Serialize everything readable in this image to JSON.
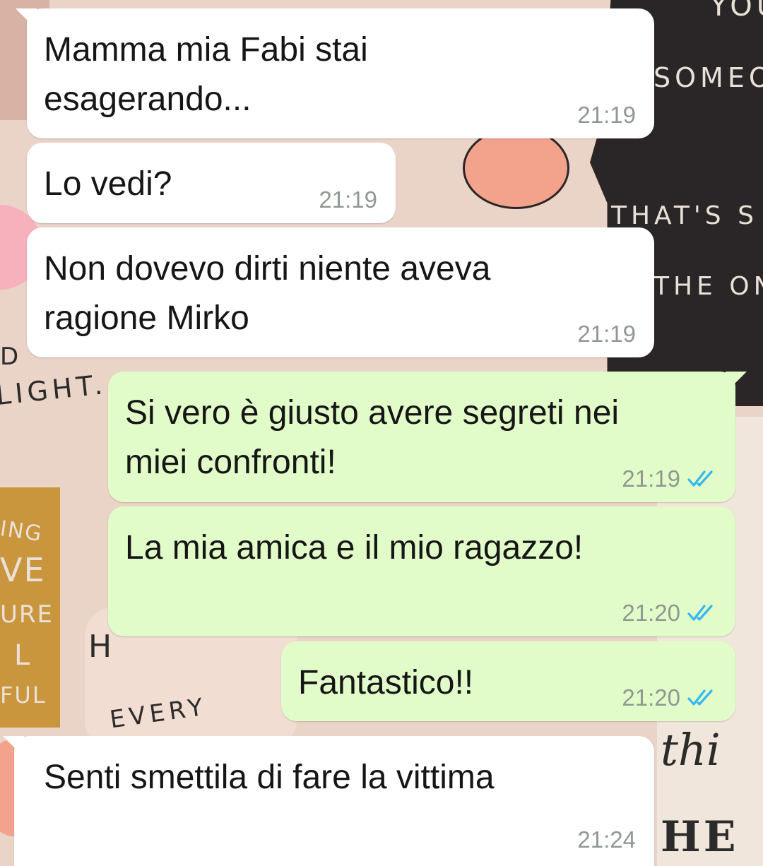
{
  "messages": [
    {
      "direction": "incoming",
      "text_lines": [
        "Mamma mia Fabi stai",
        "esagerando..."
      ],
      "time": "21:19"
    },
    {
      "direction": "incoming",
      "text_lines": [
        "Lo vedi?"
      ],
      "time": "21:19"
    },
    {
      "direction": "incoming",
      "text_lines": [
        "Non dovevo dirti niente aveva",
        "ragione Mirko"
      ],
      "time": "21:19"
    },
    {
      "direction": "outgoing",
      "text_lines": [
        "Si vero è giusto avere segreti nei",
        "miei confronti!"
      ],
      "time": "21:19",
      "status": "read-double-tick-icon"
    },
    {
      "direction": "outgoing",
      "text_lines": [
        "La mia amica e il mio ragazzo!"
      ],
      "time": "21:20",
      "status": "read-double-tick-icon"
    },
    {
      "direction": "outgoing",
      "text_lines": [
        "Fantastico!!"
      ],
      "time": "21:20",
      "status": "read-double-tick-icon"
    },
    {
      "direction": "incoming",
      "text_lines": [
        "Senti smettila di fare la vittima"
      ],
      "time": "21:24"
    }
  ],
  "wallpaper": {
    "fragments": [
      "YOU",
      "SOMEO",
      "THAT'S S",
      "THE ON",
      "D",
      "LIGHT.",
      "ING",
      "VE",
      "URE",
      "L",
      "FUL",
      "H",
      "EVERY",
      "thi",
      "HE"
    ],
    "colors": {
      "base": "#ead3c7",
      "dark_panel": "#2a2526",
      "rose": "#f3a28c",
      "gold": "#c9963e"
    }
  },
  "colors": {
    "incoming_bubble": "#ffffff",
    "outgoing_bubble": "#e2fcc9",
    "read_tick": "#34b7f1",
    "timestamp": "#8f9891"
  }
}
